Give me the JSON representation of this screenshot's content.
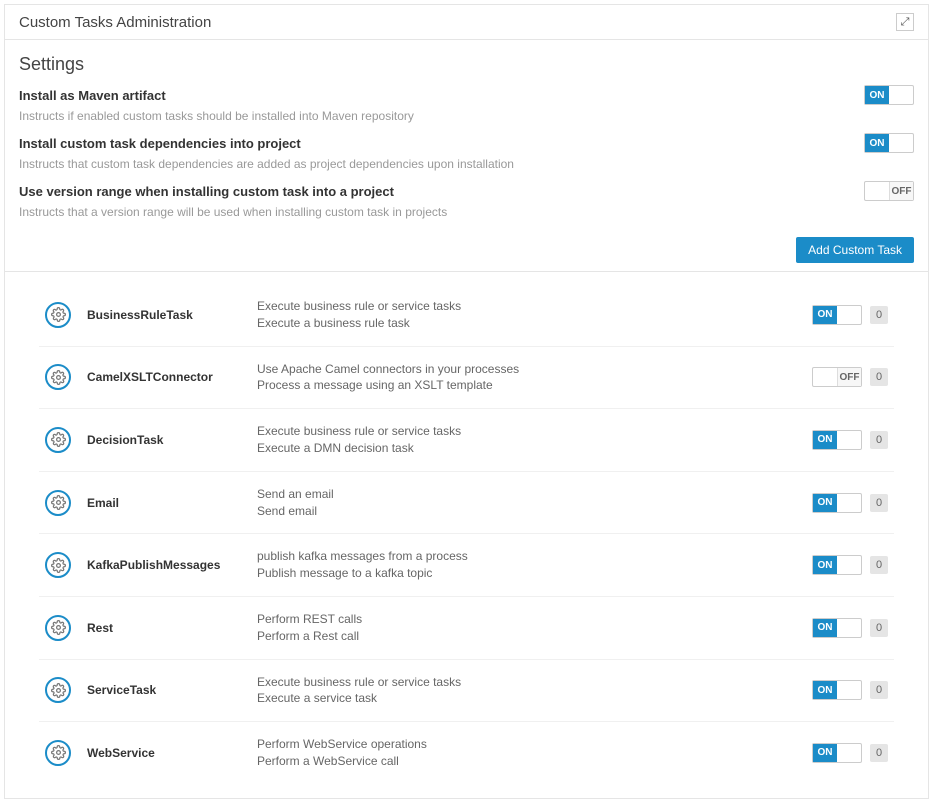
{
  "header": {
    "title": "Custom Tasks Administration"
  },
  "settings": {
    "title": "Settings",
    "items": [
      {
        "label": "Install as Maven artifact",
        "desc": "Instructs if enabled custom tasks should be installed into Maven repository",
        "state": "ON",
        "on": true
      },
      {
        "label": "Install custom task dependencies into project",
        "desc": "Instructs that custom task dependencies are added as project dependencies upon installation",
        "state": "ON",
        "on": true
      },
      {
        "label": "Use version range when installing custom task into a project",
        "desc": "Instructs that a version range will be used when installing custom task in projects",
        "state": "OFF",
        "on": false
      }
    ],
    "add_button": "Add Custom Task"
  },
  "tasks": [
    {
      "name": "BusinessRuleTask",
      "line1": "Execute business rule or service tasks",
      "line2": "Execute a business rule task",
      "state": "ON",
      "on": true,
      "count": "0"
    },
    {
      "name": "CamelXSLTConnector",
      "line1": "Use Apache Camel connectors in your processes",
      "line2": "Process a message using an XSLT template",
      "state": "OFF",
      "on": false,
      "count": "0"
    },
    {
      "name": "DecisionTask",
      "line1": "Execute business rule or service tasks",
      "line2": "Execute a DMN decision task",
      "state": "ON",
      "on": true,
      "count": "0"
    },
    {
      "name": "Email",
      "line1": "Send an email",
      "line2": "Send email",
      "state": "ON",
      "on": true,
      "count": "0"
    },
    {
      "name": "KafkaPublishMessages",
      "line1": "publish kafka messages from a process",
      "line2": "Publish message to a kafka topic",
      "state": "ON",
      "on": true,
      "count": "0"
    },
    {
      "name": "Rest",
      "line1": "Perform REST calls",
      "line2": "Perform a Rest call",
      "state": "ON",
      "on": true,
      "count": "0"
    },
    {
      "name": "ServiceTask",
      "line1": "Execute business rule or service tasks",
      "line2": "Execute a service task",
      "state": "ON",
      "on": true,
      "count": "0"
    },
    {
      "name": "WebService",
      "line1": "Perform WebService operations",
      "line2": "Perform a WebService call",
      "state": "ON",
      "on": true,
      "count": "0"
    }
  ]
}
